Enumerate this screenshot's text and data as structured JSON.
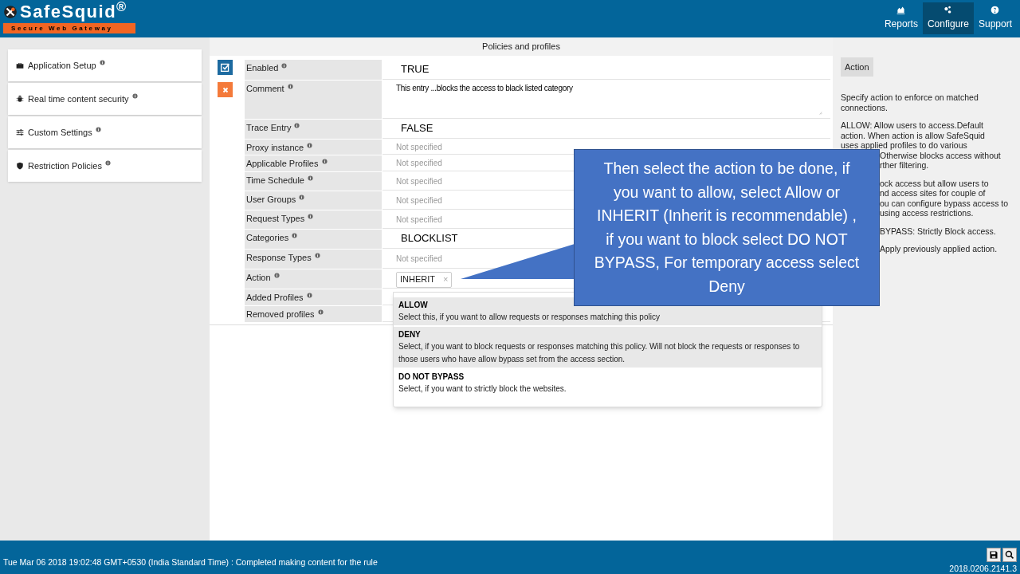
{
  "header": {
    "logo_title": "SafeSquid$^{®}$",
    "logo_subtitle": "Secure Web Gateway",
    "nav": [
      {
        "label": "Reports",
        "selected": false
      },
      {
        "label": "Configure",
        "selected": true
      },
      {
        "label": "Support",
        "selected": false
      }
    ]
  },
  "sidebar": {
    "items": [
      {
        "label": "Application Setup"
      },
      {
        "label": "Real time content security"
      },
      {
        "label": "Custom Settings"
      },
      {
        "label": "Restriction Policies"
      }
    ]
  },
  "main": {
    "title": "Policies and profiles",
    "fields": [
      {
        "label": "Enabled",
        "value": "TRUE",
        "kind": "big"
      },
      {
        "label": "Comment",
        "value": "This entry ...blocks the access to black listed category",
        "kind": "comment"
      },
      {
        "label": "Trace Entry",
        "value": "FALSE",
        "kind": "big"
      },
      {
        "label": "Proxy instance",
        "placeholder": "Not specified",
        "kind": "muted"
      },
      {
        "label": "Applicable Profiles",
        "placeholder": "Not specified",
        "kind": "muted"
      },
      {
        "label": "Time Schedule",
        "placeholder": "Not specified",
        "kind": "muted"
      },
      {
        "label": "User Groups",
        "placeholder": "Not specified",
        "kind": "muted"
      },
      {
        "label": "Request Types",
        "placeholder": "Not specified",
        "kind": "muted"
      },
      {
        "label": "Categories",
        "value": "BLOCKLIST",
        "kind": "big"
      },
      {
        "label": "Response Types",
        "placeholder": "Not specified",
        "kind": "muted"
      },
      {
        "label": "Action",
        "value": "INHERIT",
        "kind": "tag",
        "remove": "×"
      },
      {
        "label": "Added Profiles",
        "kind": "empty"
      },
      {
        "label": "Removed profiles",
        "kind": "empty"
      }
    ],
    "dropdown": [
      {
        "title": "ALLOW",
        "description": "Select this, if you want to allow requests or responses matching this policy",
        "highlighted": true
      },
      {
        "title": "DENY",
        "description": "Select, if you want to block requests or responses matching this policy. Will not block the requests or responses to those users who have allow bypass set from the access section.",
        "highlighted": true
      },
      {
        "title": "DO NOT BYPASS",
        "description": "Select, if you want to strictly block the websites.",
        "highlighted": false
      }
    ]
  },
  "help": {
    "title": "Action",
    "paragraphs": [
      [
        {
          "text": "Specify action to enforce on matched",
          "kind": "full"
        },
        {
          "text": "connections.",
          "kind": "full"
        }
      ],
      [
        {
          "text": "ALLOW: Allow users to access.Default",
          "kind": "full"
        },
        {
          "text": "action. When action is allow SafeSquid",
          "kind": "full"
        },
        {
          "text": "uses applied profiles to do various",
          "kind": "full"
        },
        {
          "text": "Otherwise blocks access without",
          "kind": "cut"
        },
        {
          "text": "rther filtering.",
          "kind": "cut"
        }
      ],
      [
        {
          "text": "ock access but allow users to",
          "kind": "cut"
        },
        {
          "text": "nd access sites for couple of",
          "kind": "cut"
        },
        {
          "text": "ou can configure bypass access to",
          "kind": "cut"
        },
        {
          "text": "using access restrictions.",
          "kind": "cut"
        }
      ],
      [
        {
          "text": "BYPASS: Strictly Block access.",
          "kind": "cut"
        }
      ],
      [
        {
          "text": "Apply previously applied action.",
          "kind": "cut"
        }
      ]
    ]
  },
  "callout": {
    "text": "Then select the action to be done, if you want to allow, select Allow or INHERIT (Inherit is recommendable) , if you want to block select DO NOT BYPASS, For temporary access select Deny"
  },
  "status_bar": {
    "message": "Tue Mar 06 2018 19:02:48 GMT+0530 (India Standard Time) : Completed making content for the rule",
    "version": "2018.0206.2141.3"
  }
}
